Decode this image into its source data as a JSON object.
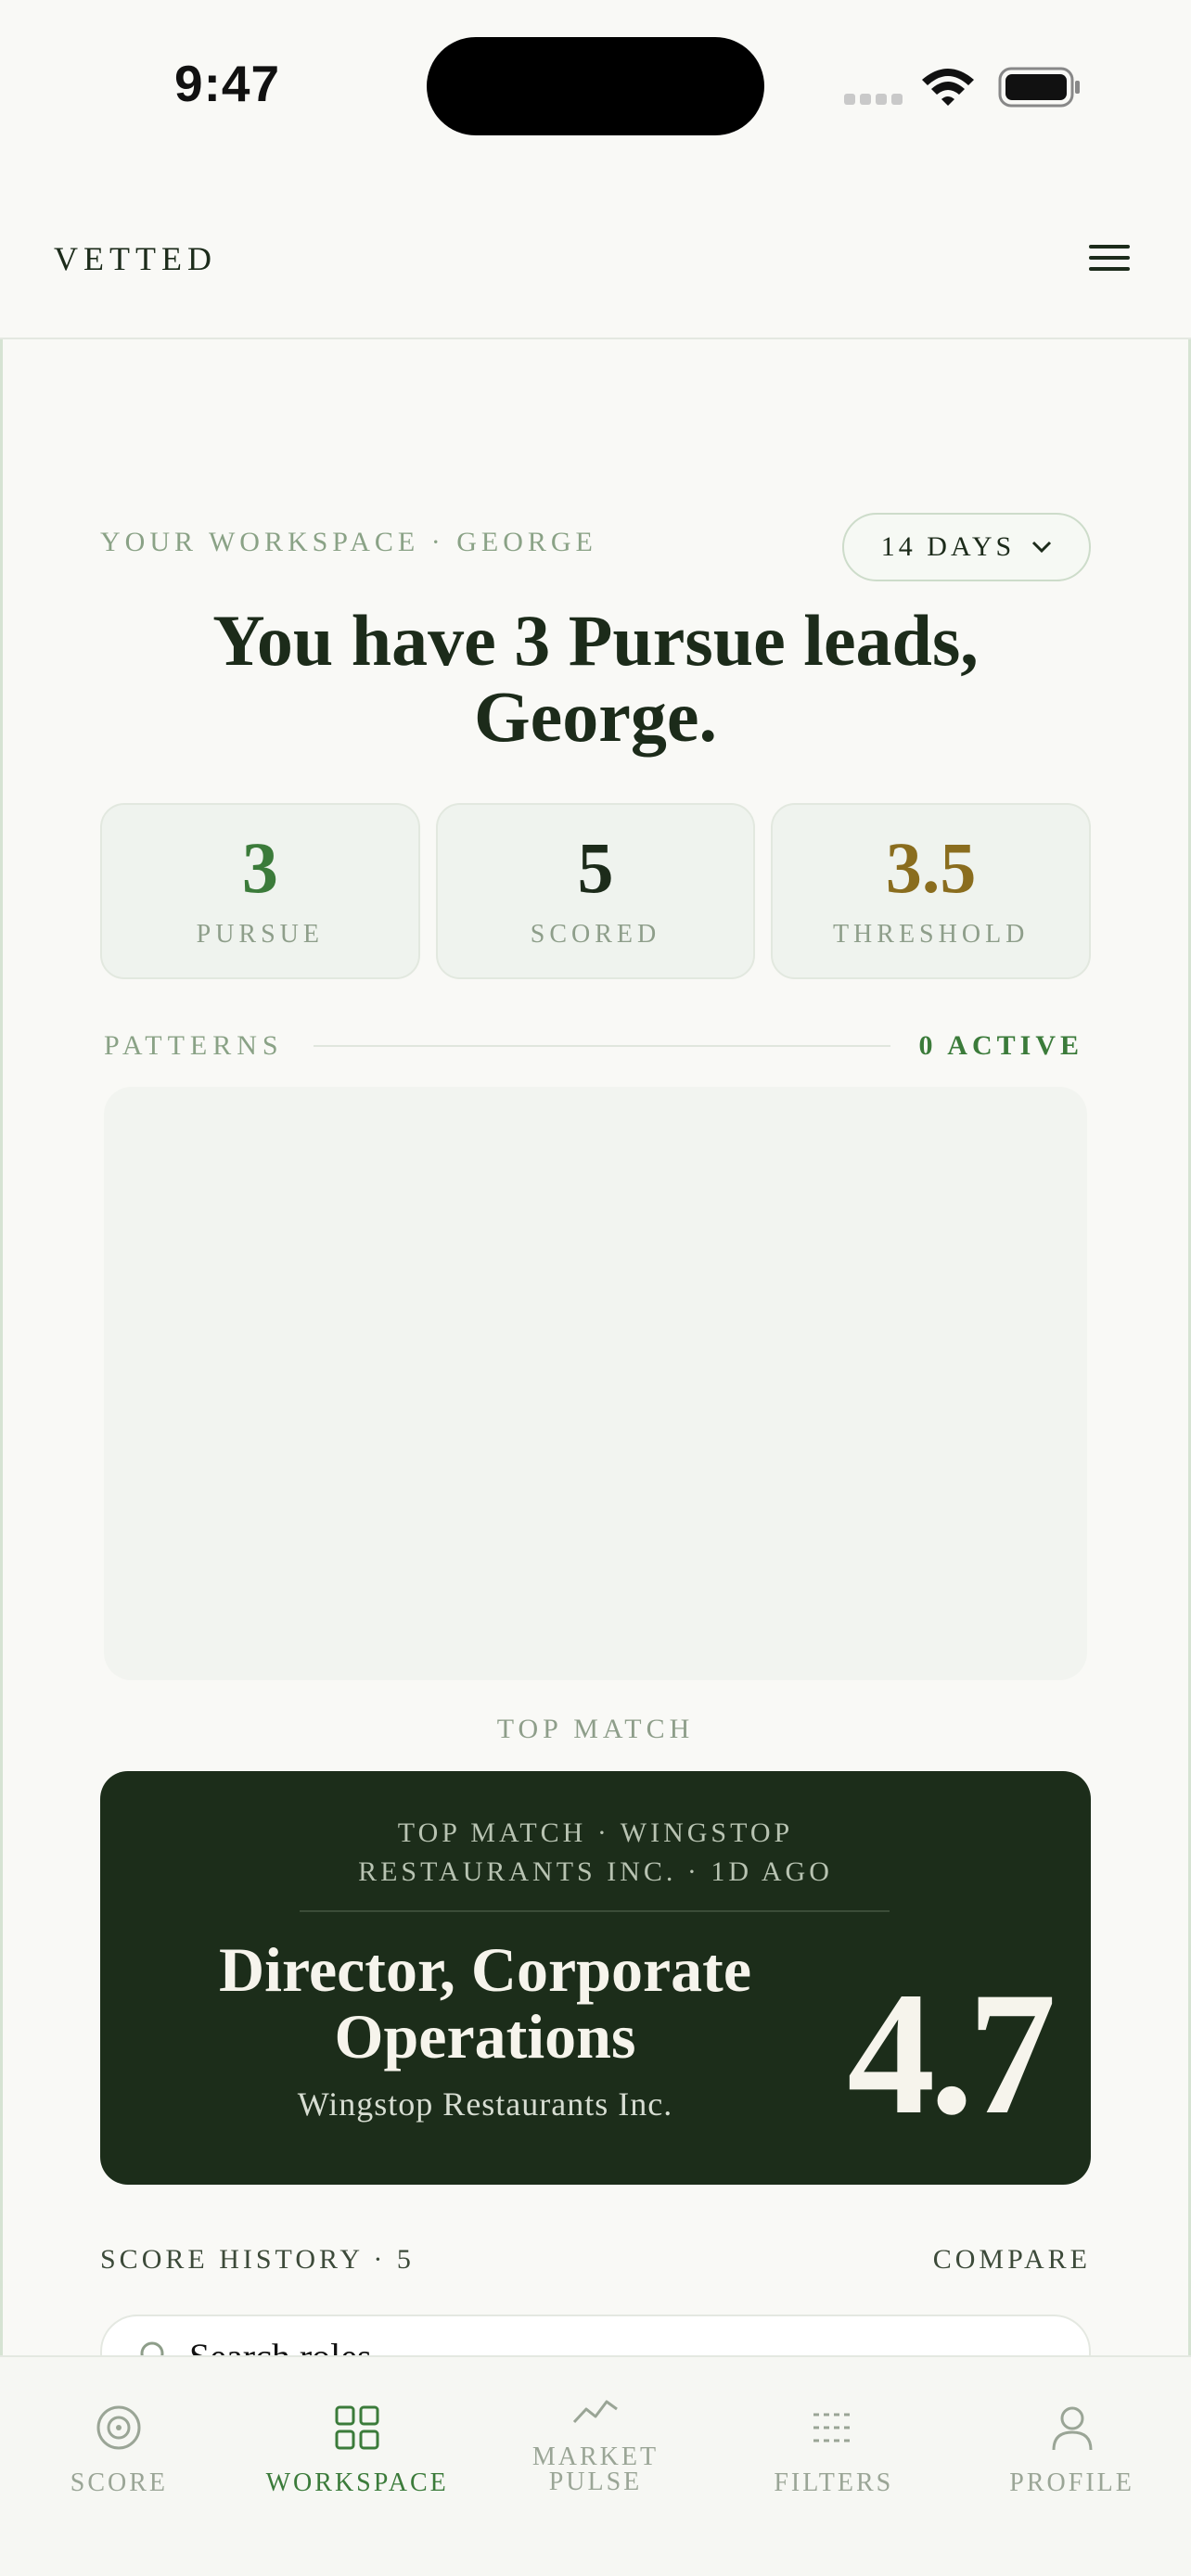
{
  "status_bar": {
    "time": "9:47"
  },
  "header": {
    "brand": "VETTED"
  },
  "workspace": {
    "eyebrow": "YOUR WORKSPACE · GEORGE",
    "range": "14 DAYS",
    "headline": "You have 3 Pursue leads, George."
  },
  "stats": [
    {
      "value": "3",
      "label": "PURSUE",
      "color": "#3b7b3a"
    },
    {
      "value": "5",
      "label": "SCORED",
      "color": "#1c2b1a"
    },
    {
      "value": "3.5",
      "label": "THRESHOLD",
      "color": "#8a6d1e"
    }
  ],
  "patterns": {
    "label": "PATTERNS",
    "active": "0 ACTIVE"
  },
  "top_match": {
    "section_label": "TOP MATCH",
    "meta_line1": "TOP MATCH · WINGSTOP",
    "meta_line2": "RESTAURANTS INC. · 1D AGO",
    "title": "Director, Corporate Operations",
    "company": "Wingstop Restaurants Inc.",
    "score": "4.7"
  },
  "history": {
    "label": "SCORE HISTORY · 5",
    "compare": "COMPARE"
  },
  "search": {
    "placeholder": "Search roles"
  },
  "tabs": [
    {
      "label": "SCORE",
      "icon": "target-icon",
      "active": false
    },
    {
      "label": "WORKSPACE",
      "icon": "grid-icon",
      "active": true
    },
    {
      "label": "MARKET PULSE",
      "icon": "trend-icon",
      "active": false
    },
    {
      "label": "FILTERS",
      "icon": "filter-icon",
      "active": false
    },
    {
      "label": "PROFILE",
      "icon": "user-icon",
      "active": false
    }
  ]
}
